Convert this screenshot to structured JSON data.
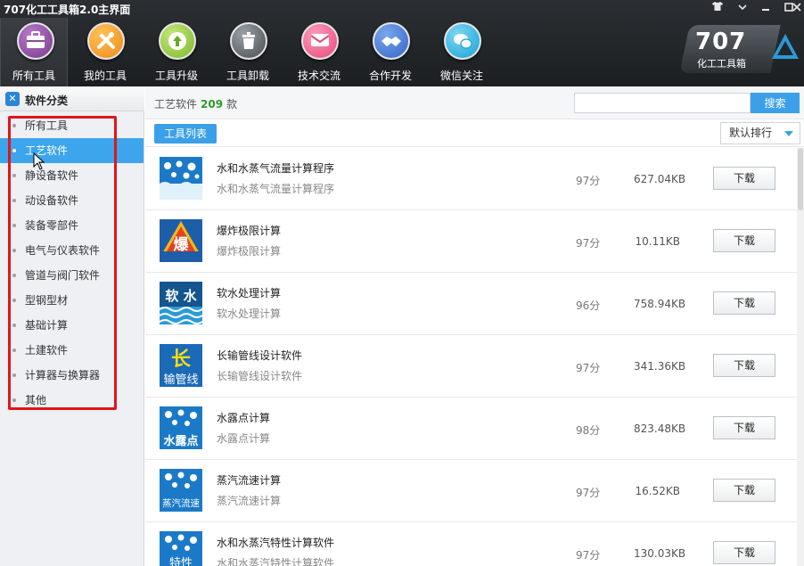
{
  "app": {
    "title": "707化工工具箱2.0主界面",
    "window_controls": [
      {
        "name": "skin",
        "glyph": "👕"
      },
      {
        "name": "menu",
        "glyph": "⌄"
      },
      {
        "name": "minimize",
        "glyph": "—"
      },
      {
        "name": "maximize",
        "glyph": "▢"
      },
      {
        "name": "close",
        "glyph": "✕"
      }
    ]
  },
  "toolbar": [
    {
      "label": "所有工具",
      "icon": "toolbox-icon",
      "glyph": "▣",
      "color": "#7a3a8c",
      "active": true
    },
    {
      "label": "我的工具",
      "icon": "wrench-icon",
      "glyph": "✚",
      "color": "#f08a18",
      "active": false
    },
    {
      "label": "工具升级",
      "icon": "upgrade-arrow-icon",
      "glyph": "↑",
      "color": "#7dba2a",
      "active": false
    },
    {
      "label": "工具卸载",
      "icon": "trash-icon",
      "glyph": "▥",
      "color": "#5b5f63",
      "active": false
    },
    {
      "label": "技术交流",
      "icon": "chat-icon",
      "glyph": "✉",
      "color": "#e8487c",
      "active": false
    },
    {
      "label": "合作开发",
      "icon": "handshake-icon",
      "glyph": "✋",
      "color": "#3266c4",
      "active": false
    },
    {
      "label": "微信关注",
      "icon": "wechat-icon",
      "glyph": "✆",
      "color": "#1aa3d8",
      "active": false
    }
  ],
  "logo": {
    "number": "707",
    "name": "化工工具箱"
  },
  "sidebar": {
    "title": "软件分类",
    "items": [
      {
        "label": "所有工具"
      },
      {
        "label": "工艺软件",
        "selected": true
      },
      {
        "label": "静设备软件"
      },
      {
        "label": "动设备软件"
      },
      {
        "label": "装备零部件"
      },
      {
        "label": "电气与仪表软件"
      },
      {
        "label": "管道与阀门软件"
      },
      {
        "label": "型钢型材"
      },
      {
        "label": "基础计算"
      },
      {
        "label": "土建软件"
      },
      {
        "label": "计算器与换算器"
      },
      {
        "label": "其他"
      }
    ]
  },
  "main": {
    "category": "工艺软件",
    "count": "209",
    "count_unit": "款",
    "search_placeholder": "",
    "search_button": "搜索",
    "tab": "工具列表",
    "sort": "默认排行",
    "download_label": "下载",
    "items": [
      {
        "name": "水和水蒸气流量计算程序",
        "desc": "水和水蒸气流量计算程序",
        "score": "97分",
        "size": "627.04KB",
        "icon": "water-bubbles-icon",
        "badge": ""
      },
      {
        "name": "爆炸极限计算",
        "desc": "爆炸极限计算",
        "score": "97分",
        "size": "10.11KB",
        "icon": "explosion-icon",
        "badge": "爆"
      },
      {
        "name": "软水处理计算",
        "desc": "软水处理计算",
        "score": "96分",
        "size": "758.94KB",
        "icon": "soft-water-icon",
        "badge": "软 水"
      },
      {
        "name": "长输管线设计软件",
        "desc": "长输管线设计软件",
        "score": "97分",
        "size": "341.36KB",
        "icon": "pipeline-icon",
        "badge": "长",
        "badge2": "输管线"
      },
      {
        "name": "水露点计算",
        "desc": "水露点计算",
        "score": "98分",
        "size": "823.48KB",
        "icon": "dew-point-icon",
        "badge": "水露点"
      },
      {
        "name": "蒸汽流速计算",
        "desc": "蒸汽流速计算",
        "score": "97分",
        "size": "16.52KB",
        "icon": "steam-velocity-icon",
        "badge": "蒸汽流速"
      },
      {
        "name": "水和水蒸汽特性计算软件",
        "desc": "水和水蒸汽特性计算软件",
        "score": "97分",
        "size": "130.03KB",
        "icon": "steam-properties-icon",
        "badge": "特性"
      }
    ]
  },
  "colors": {
    "accent": "#3ca0e8",
    "header_bg": "#23272b",
    "highlight_box": "#e0151b",
    "count_green": "#2e9a2e"
  }
}
